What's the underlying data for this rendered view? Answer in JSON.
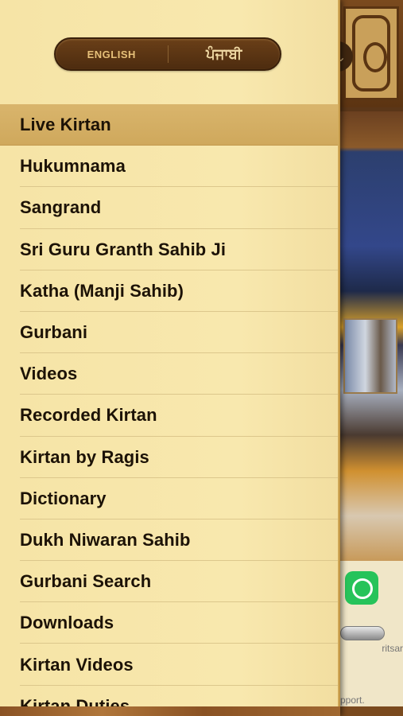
{
  "language_toggle": {
    "english_label": "ENGLISH",
    "punjabi_label": "ਪੰਜਾਬੀ"
  },
  "menu": {
    "items": [
      {
        "label": "Live Kirtan",
        "active": true
      },
      {
        "label": "Hukumnama"
      },
      {
        "label": "Sangrand"
      },
      {
        "label": "Sri Guru Granth Sahib Ji"
      },
      {
        "label": "Katha (Manji Sahib)"
      },
      {
        "label": "Gurbani"
      },
      {
        "label": "Videos"
      },
      {
        "label": "Recorded Kirtan"
      },
      {
        "label": "Kirtan by Ragis"
      },
      {
        "label": "Dictionary"
      },
      {
        "label": "Dukh Niwaran Sahib"
      },
      {
        "label": "Gurbani Search"
      },
      {
        "label": "Downloads"
      },
      {
        "label": "Kirtan Videos"
      },
      {
        "label": "Kirtan Duties"
      }
    ]
  },
  "background": {
    "text_partial_1": "ritsar",
    "text_partial_2": "pport."
  },
  "colors": {
    "drawer_bg": "#f8e8ae",
    "active_item": "#d4ae62",
    "toggle_bg": "#5a3414",
    "whatsapp": "#26c35a"
  }
}
